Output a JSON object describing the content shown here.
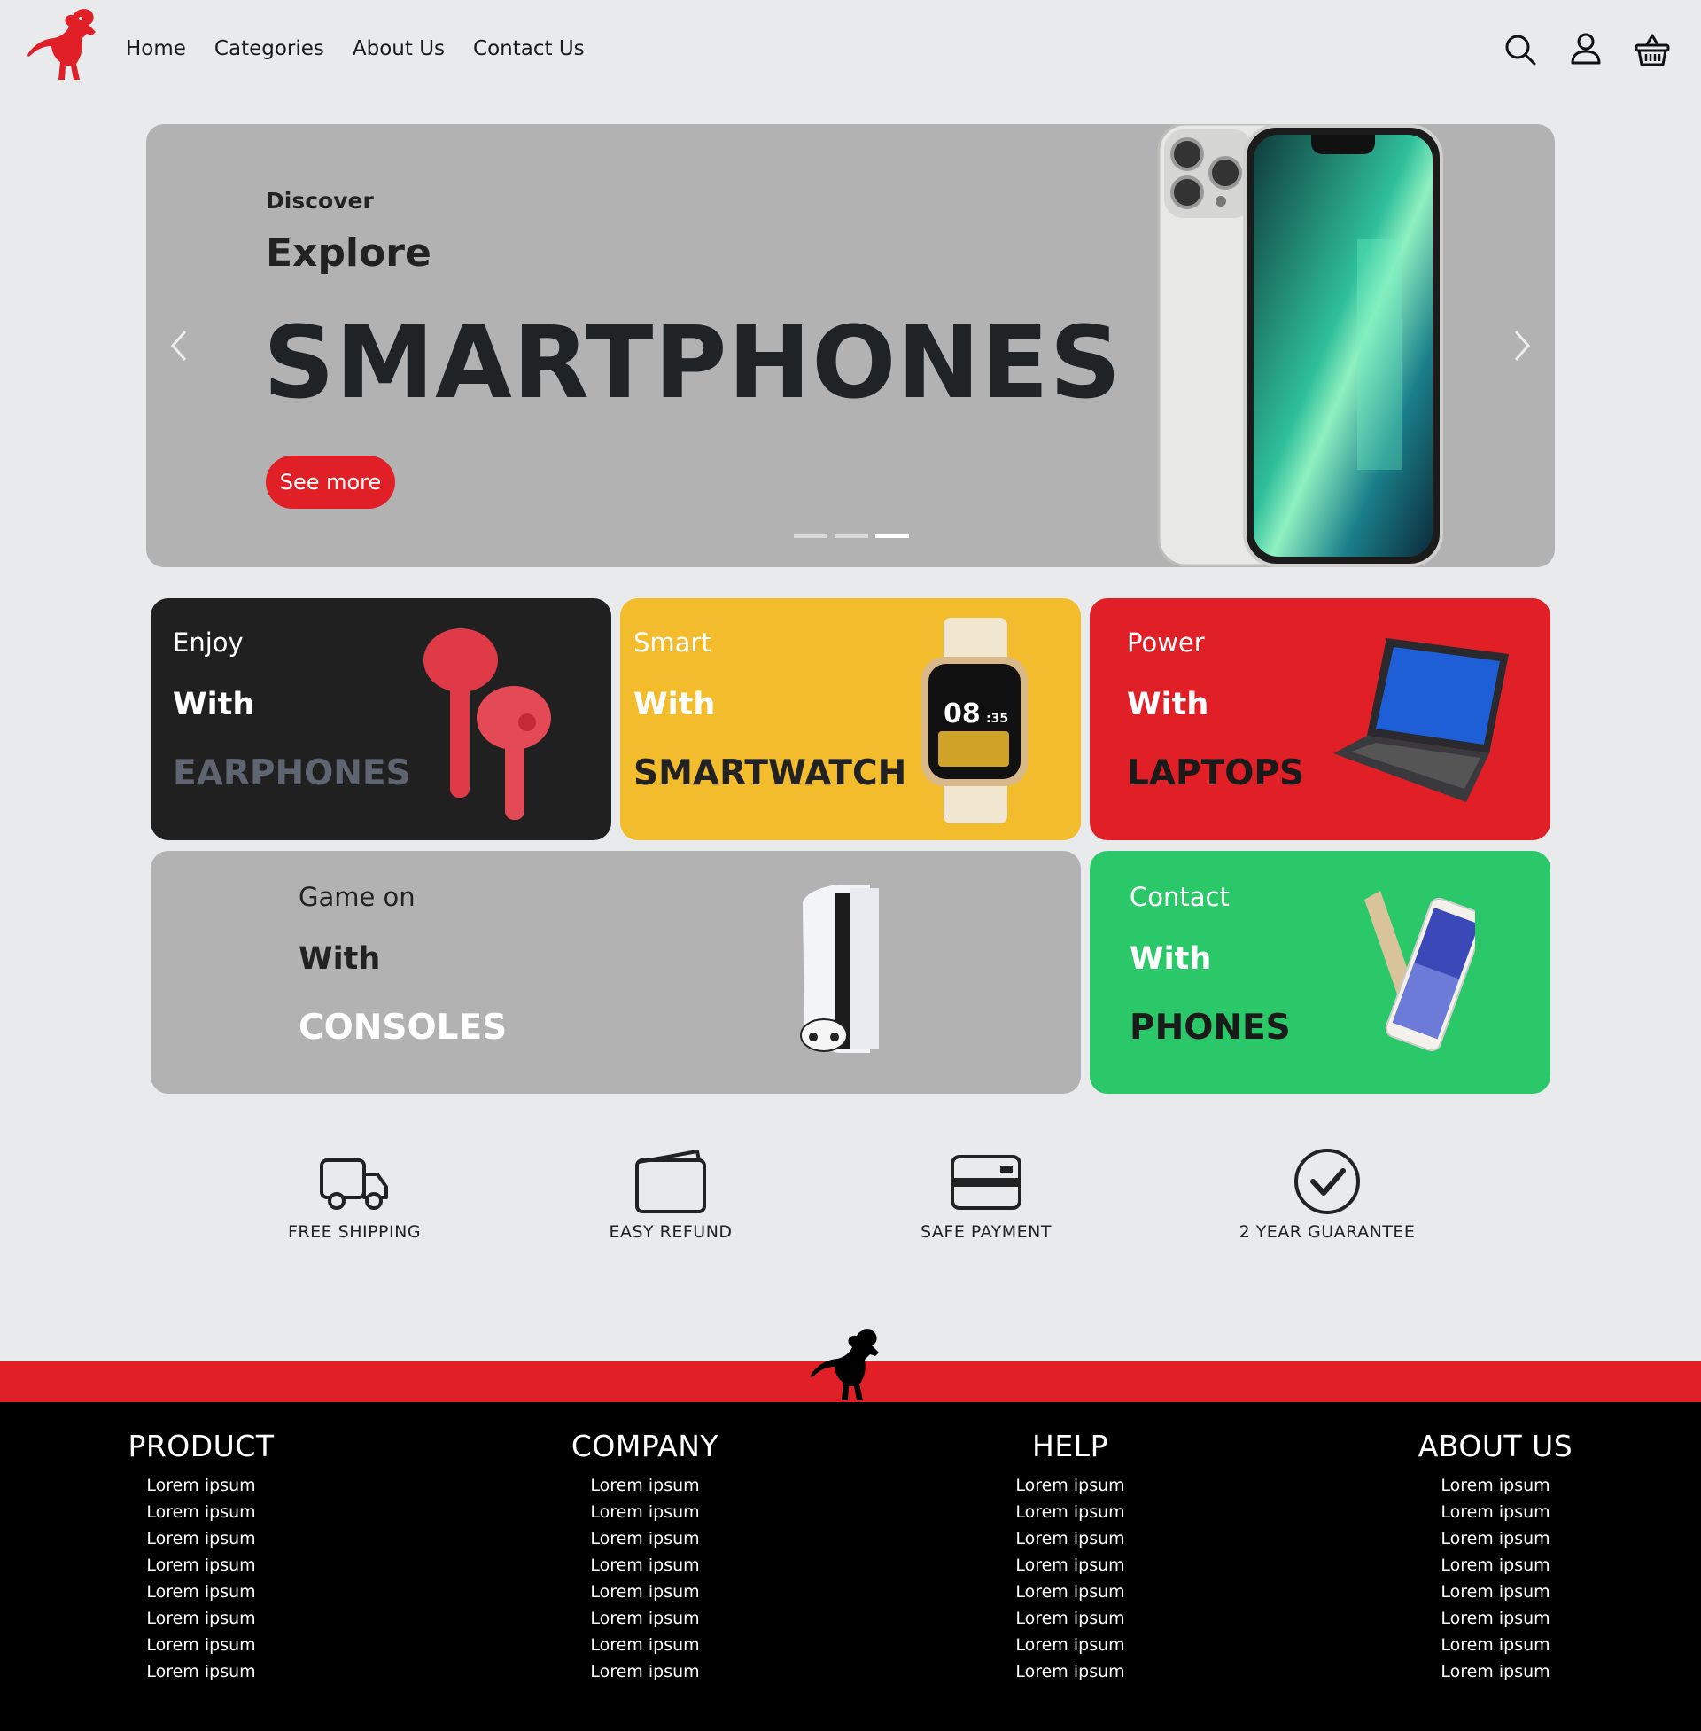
{
  "nav": {
    "links": [
      "Home",
      "Categories",
      "About Us",
      "Contact Us"
    ]
  },
  "hero": {
    "eyebrow": "Discover",
    "sub": "Explore",
    "headline": "SMARTPHONES",
    "cta": "See more",
    "slides_total": 3,
    "active_slide": 3
  },
  "cards": {
    "earphones": {
      "l1": "Enjoy",
      "l2": "With",
      "l3": "EARPHONES"
    },
    "smartwatch": {
      "l1": "Smart",
      "l2": "With",
      "l3": "SMARTWATCH"
    },
    "laptops": {
      "l1": "Power",
      "l2": "With",
      "l3": "LAPTOPS"
    },
    "consoles": {
      "l1": "Game on",
      "l2": "With",
      "l3": "CONSOLES"
    },
    "phones": {
      "l1": "Contact",
      "l2": "With",
      "l3": "PHONES"
    }
  },
  "watch_face": {
    "time": "08",
    "minutes": ":35"
  },
  "features": [
    "FREE SHIPPING",
    "EASY REFUND",
    "SAFE PAYMENT",
    "2 YEAR GUARANTEE"
  ],
  "footer": {
    "columns": [
      {
        "title": "PRODUCT",
        "items": [
          "Lorem ipsum",
          "Lorem ipsum",
          "Lorem ipsum",
          "Lorem ipsum",
          "Lorem ipsum",
          "Lorem ipsum",
          "Lorem ipsum",
          "Lorem ipsum"
        ]
      },
      {
        "title": "COMPANY",
        "items": [
          "Lorem ipsum",
          "Lorem ipsum",
          "Lorem ipsum",
          "Lorem ipsum",
          "Lorem ipsum",
          "Lorem ipsum",
          "Lorem ipsum",
          "Lorem ipsum"
        ]
      },
      {
        "title": "HELP",
        "items": [
          "Lorem ipsum",
          "Lorem ipsum",
          "Lorem ipsum",
          "Lorem ipsum",
          "Lorem ipsum",
          "Lorem ipsum",
          "Lorem ipsum",
          "Lorem ipsum"
        ]
      },
      {
        "title": "ABOUT US",
        "items": [
          "Lorem ipsum",
          "Lorem ipsum",
          "Lorem ipsum",
          "Lorem ipsum",
          "Lorem ipsum",
          "Lorem ipsum",
          "Lorem ipsum",
          "Lorem ipsum"
        ]
      }
    ]
  },
  "colors": {
    "brand_red": "#e11f26",
    "page_bg": "#e9eaec",
    "hero_bg": "#b2b2b2",
    "yellow": "#f2bc2c",
    "green": "#2bc86a",
    "dark": "#202020"
  },
  "icons": {
    "logo": "dinosaur-logo-icon",
    "search": "search-icon",
    "account": "user-icon",
    "cart": "basket-icon",
    "features": [
      "truck-icon",
      "wallet-icon",
      "credit-card-icon",
      "check-circle-icon"
    ]
  }
}
